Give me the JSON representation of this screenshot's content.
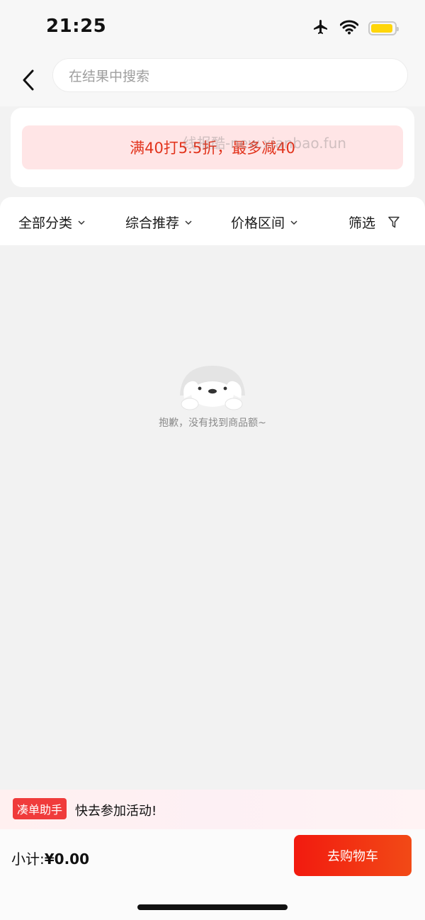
{
  "status_bar": {
    "time": "21:25",
    "icons": [
      "airplane-icon",
      "wifi-icon",
      "battery-icon"
    ],
    "battery_color": "#ffd60a"
  },
  "search": {
    "placeholder": "在结果中搜索"
  },
  "promo": {
    "text": "满40打5.5折，最多减40",
    "color": "#e2341d",
    "background": "#ffe5e6"
  },
  "watermark": {
    "text": "线报酷-new.xianbao.fun"
  },
  "filters": [
    {
      "label": "全部分类",
      "icon": "chevron-down-icon"
    },
    {
      "label": "综合推荐",
      "icon": "chevron-down-icon"
    },
    {
      "label": "价格区间",
      "icon": "chevron-down-icon"
    },
    {
      "label": "筛选",
      "icon": "filter-icon"
    }
  ],
  "empty_state": {
    "message": "抱歉，没有找到商品额~"
  },
  "helper": {
    "tag": "凑单助手",
    "text": "快去参加活动!"
  },
  "footer": {
    "subtotal_label": "小计:",
    "subtotal_value": "¥0.00",
    "cart_button": "去购物车"
  },
  "colors": {
    "accent": "#f21a0f",
    "page_bg": "#f2f2f2"
  }
}
